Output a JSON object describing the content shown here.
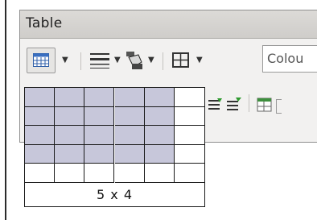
{
  "toolbar": {
    "title": "Table",
    "colour_field_text": "Colou"
  },
  "table_popup": {
    "columns": 6,
    "rows": 5,
    "selected_columns": 5,
    "selected_rows": 4,
    "size_label": "5 x 4",
    "selected_color": "#c7c7da"
  },
  "icons": {
    "table": "insert-table-icon",
    "borders_style": "line-style-icon",
    "fill": "paint-bucket-icon",
    "borders": "borders-icon",
    "dropdown": "chevron-down-icon"
  }
}
